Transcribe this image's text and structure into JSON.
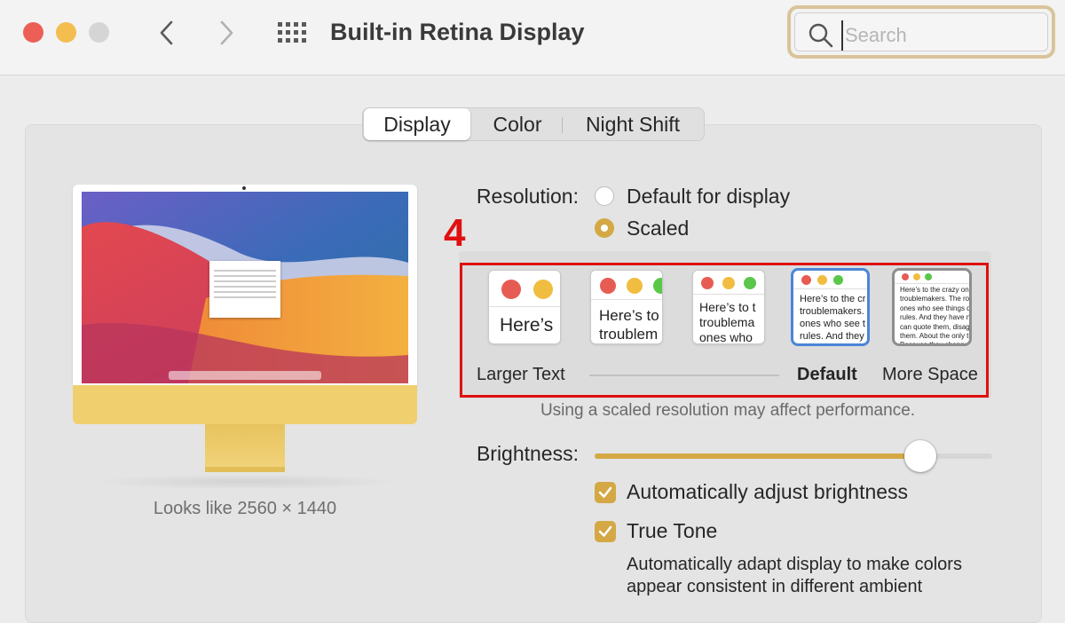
{
  "window": {
    "title": "Built-in Retina Display"
  },
  "search": {
    "placeholder": "Search"
  },
  "tabs": [
    {
      "label": "Display",
      "selected": true
    },
    {
      "label": "Color",
      "selected": false
    },
    {
      "label": "Night Shift",
      "selected": false
    }
  ],
  "preview": {
    "looks_like": "Looks like 2560 × 1440"
  },
  "resolution": {
    "label": "Resolution:",
    "options": [
      {
        "label": "Default for display",
        "selected": false
      },
      {
        "label": "Scaled",
        "selected": true
      }
    ]
  },
  "annotation": {
    "step": "4"
  },
  "scaled": {
    "thumbnails": [
      {
        "text": "Here’s",
        "selected": false
      },
      {
        "text": "Here’s to\ntroublem",
        "selected": false
      },
      {
        "text": "Here’s to t\ntroublema\nones who",
        "selected": false
      },
      {
        "text": "Here’s to the cr\ntroublemakers.\nones who see t\nrules. And they",
        "selected": true
      },
      {
        "text": "Here’s to the crazy one\ntroublemakers. The rou\nones who see things dif\nrules. And they have no\ncan quote them, disagr\nthem. About the only th\nBecause they change t",
        "selected": false
      }
    ],
    "larger_text_label": "Larger Text",
    "default_label": "Default",
    "more_space_label": "More Space",
    "note": "Using a scaled resolution may affect performance."
  },
  "brightness": {
    "label": "Brightness:",
    "level": 0.82
  },
  "options": {
    "auto_brightness": {
      "label": "Automatically adjust brightness",
      "checked": true
    },
    "true_tone": {
      "label": "True Tone",
      "checked": true
    },
    "true_tone_description": "Automatically adapt display to make colors appear consistent in different ambient"
  },
  "colors": {
    "accent": "#d4a845",
    "annotation_red": "#e01010",
    "selected_blue": "#4a86d8",
    "imac_yellow": "#f0cf6e"
  }
}
